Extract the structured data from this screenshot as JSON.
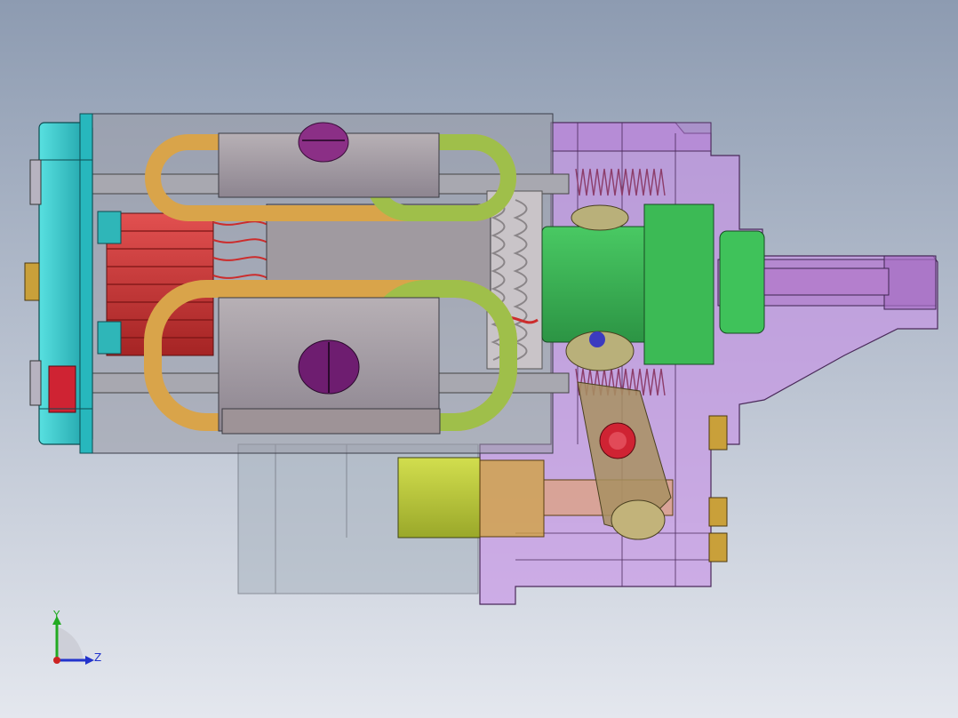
{
  "viewport": {
    "background_top": "#8d9bb1",
    "background_bottom": "#e4e7ee"
  },
  "model": {
    "colors": {
      "end_cap": "#2ec9c9",
      "commutator": "#d43a3a",
      "coil": "#d9a44a",
      "coil_green": "#9fbf4a",
      "pole": "#a69aa0",
      "housing": "#9a9ca8",
      "gear_housing": "#c58fe0",
      "green_hub": "#3cba55",
      "spring": "#8c3d6a",
      "screw": "#8b2f86",
      "yellow_block": "#c3d13c",
      "brass": "#d1a23a",
      "red_pin": "#cf2333",
      "nut": "#c9a03a"
    }
  },
  "triad": {
    "y_label": "Y",
    "z_label": "Z",
    "y_color": "#22aa22",
    "z_color": "#2233cc",
    "x_color": "#cc2222"
  }
}
